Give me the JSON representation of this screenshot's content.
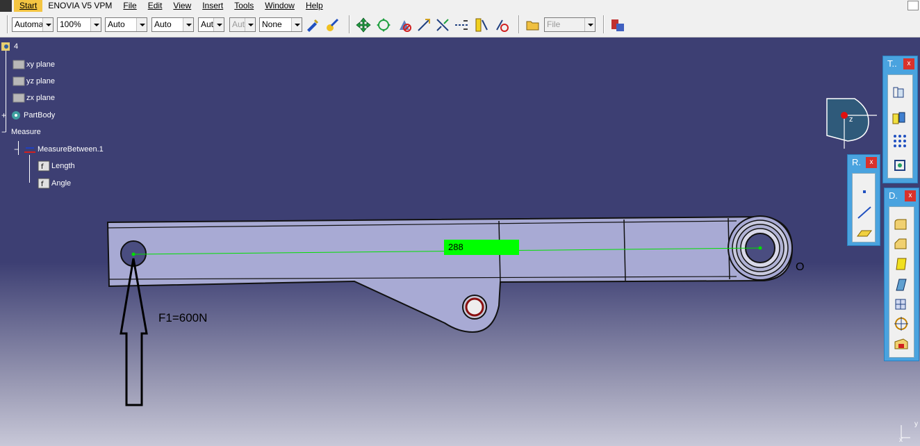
{
  "menu": {
    "start": "Start",
    "app": "ENOVIA V5 VPM",
    "file": "File",
    "edit": "Edit",
    "view": "View",
    "insert": "Insert",
    "tools": "Tools",
    "window": "Window",
    "help": "Help"
  },
  "toolbar": {
    "combo1": "Automa",
    "combo2": "100%",
    "combo3": "Auto",
    "combo4": "Auto",
    "combo5": "Aut",
    "combo6": "Aut",
    "combo7": "None",
    "file_combo": "File"
  },
  "tree": {
    "root": "4",
    "items": [
      {
        "label": "xy plane"
      },
      {
        "label": "yz plane"
      },
      {
        "label": "zx plane"
      },
      {
        "label": "PartBody"
      },
      {
        "label": "Measure"
      },
      {
        "label": "MeasureBetween.1"
      },
      {
        "label": "Length"
      },
      {
        "label": "Angle"
      }
    ]
  },
  "viewport": {
    "measure_value": "288",
    "force_label": "F1=600N",
    "pivot_label": "O",
    "compass_z": "z",
    "axis_y": "y",
    "axis_x": "x"
  },
  "panels": {
    "t_title": "T..",
    "r_title": "R.",
    "d_title": "D.",
    "close": "x"
  },
  "colors": {
    "background_top": "#3d3f73",
    "background_bottom": "#b0b0c8",
    "part_fill": "#a9abd6",
    "measure_highlight": "#00ff00",
    "panel": "#4aa3df",
    "active_menu": "#f4c542"
  }
}
